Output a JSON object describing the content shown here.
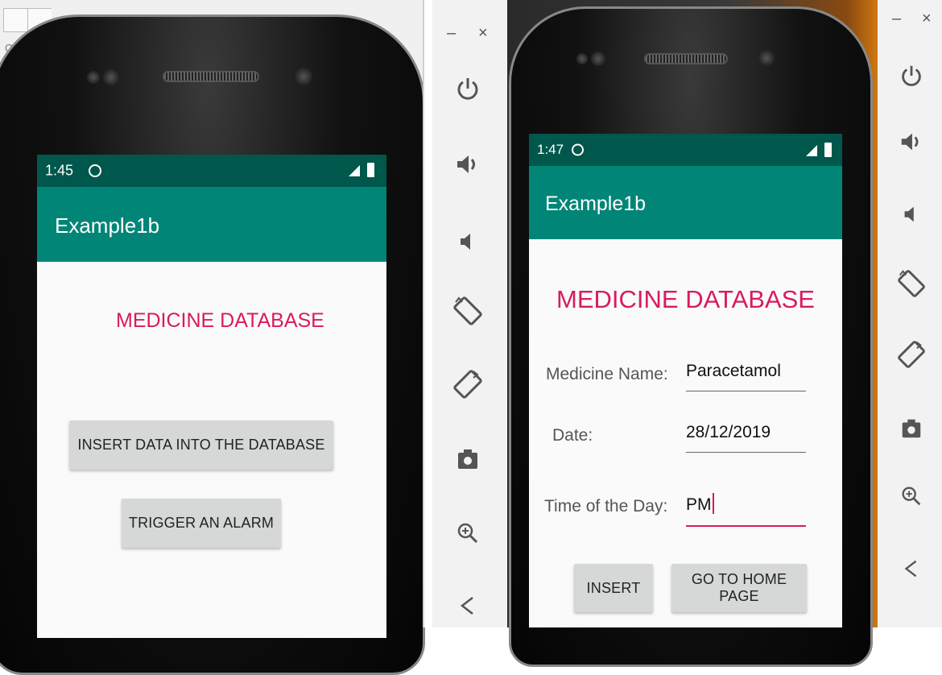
{
  "left_backdrop": {
    "text_fragment": "Colo"
  },
  "left_phone": {
    "status_time": "1:45",
    "app_title": "Example1b",
    "heading": "MEDICINE DATABASE",
    "buttons": [
      {
        "label": "INSERT DATA INTO THE DATABASE"
      },
      {
        "label": "TRIGGER AN ALARM"
      }
    ]
  },
  "right_phone": {
    "status_time": "1:47",
    "app_title": "Example1b",
    "heading": "MEDICINE DATABASE",
    "fields": [
      {
        "label": "Medicine Name:",
        "value": "Paracetamol"
      },
      {
        "label": "Date:",
        "value": "28/12/2019"
      },
      {
        "label": "Time of the Day:",
        "value": "PM"
      }
    ],
    "buttons": [
      {
        "label": "INSERT"
      },
      {
        "label": "GO TO HOME PAGE"
      }
    ]
  },
  "emulator_toolbar": {
    "minimize": "–",
    "close": "×",
    "tools": [
      "power-icon",
      "volume-up-icon",
      "volume-down-icon",
      "rotate-left-icon",
      "rotate-right-icon",
      "screenshot-icon",
      "zoom-icon",
      "back-icon"
    ]
  },
  "colors": {
    "primary": "#008577",
    "primary_dark": "#00574b",
    "accent": "#d81b60",
    "button": "#d6d7d7"
  }
}
